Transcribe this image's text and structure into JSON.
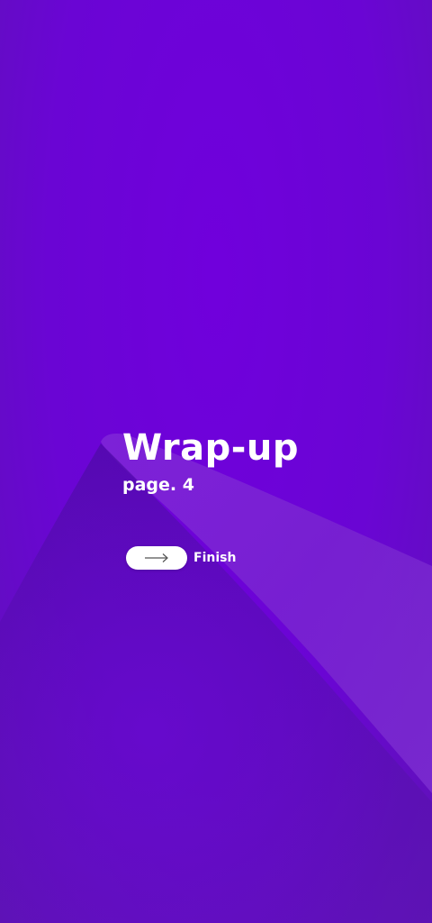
{
  "page": {
    "title": "Wrap-up",
    "subtitle": "page. 4"
  },
  "actions": {
    "finish_label": "Finish",
    "finish_icon": "arrow-right-icon"
  },
  "colors": {
    "background": "#6a05d4",
    "accent_light": "#7a2cd0",
    "accent_dark": "#5410b0",
    "text": "#ffffff"
  }
}
